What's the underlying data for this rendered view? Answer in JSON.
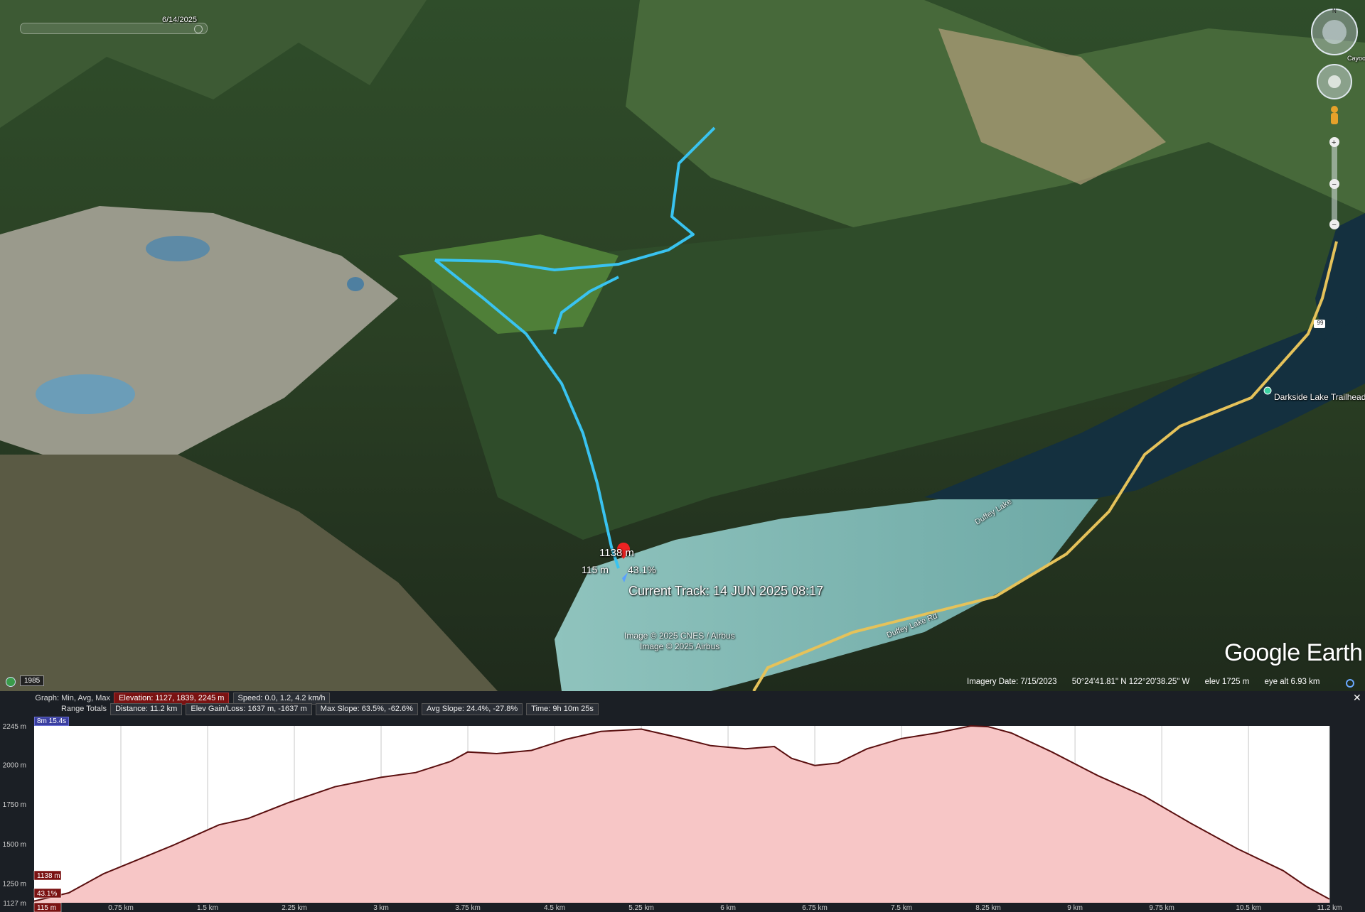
{
  "app": {
    "name": "Google Earth",
    "logo_text": "Google Earth"
  },
  "timeline": {
    "date": "6/14/2025",
    "year_badge": "1985"
  },
  "map": {
    "labels": {
      "elev_marker": "1138 m",
      "dist_marker": "115 m",
      "slope_marker": "43.1%",
      "current_track": "Current Track: 14 JUN 2025 08:17",
      "trailhead": "Darkside Lake Trailhead",
      "lake": "Duffey Lake",
      "road": "Duffey Lake Rd",
      "highway": "99",
      "cayoosh": "Cayoos",
      "credit1": "Image © 2025 CNES / Airbus",
      "credit2": "Image © 2025 Airbus"
    }
  },
  "status_bar": {
    "imagery_date": "Imagery Date: 7/15/2023",
    "coords": "50°24'41.81\" N  122°20'38.25\" W",
    "elev": "elev  1725 m",
    "eye_alt": "eye alt   6.93 km"
  },
  "profile": {
    "row1_label": "Graph: Min, Avg, Max",
    "elevation": "Elevation: 1127, 1839, 2245 m",
    "speed": "Speed: 0.0, 1.2, 4.2 km/h",
    "row2_label": "Range Totals",
    "distance": "Distance: 11.2 km",
    "elev_gain": "Elev Gain/Loss: 1637 m, -1637 m",
    "max_slope": "Max Slope: 63.5%, -62.6%",
    "avg_slope": "Avg Slope: 24.4%, -27.8%",
    "time": "Time: 9h 10m 25s",
    "time_badge": "8m 15.4s",
    "cursor_elev": "1138 m",
    "cursor_slope": "43.1%",
    "cursor_dist": "115 m"
  },
  "colors": {
    "fill": "#f7c6c6",
    "line": "#5a0f0f",
    "track": "#39c3f0"
  },
  "chart_data": {
    "type": "area",
    "xlabel": "",
    "ylabel": "",
    "x_unit": "km",
    "y_unit": "m",
    "xlim": [
      0,
      11.2
    ],
    "ylim": [
      1127,
      2245
    ],
    "x_ticks": [
      "0.75 km",
      "1.5 km",
      "2.25 km",
      "3 km",
      "3.75 km",
      "4.5 km",
      "5.25 km",
      "6 km",
      "6.75 km",
      "7.5 km",
      "8.25 km",
      "9 km",
      "9.75 km",
      "10.5 km",
      "11.2 km"
    ],
    "y_ticks": [
      "2245 m",
      "2000 m",
      "1750 m",
      "1500 m",
      "1250 m",
      "1127 m"
    ],
    "x": [
      0,
      0.3,
      0.6,
      0.9,
      1.2,
      1.6,
      1.85,
      2.2,
      2.6,
      3.0,
      3.3,
      3.6,
      3.75,
      4.0,
      4.3,
      4.6,
      4.9,
      5.25,
      5.55,
      5.85,
      6.15,
      6.4,
      6.55,
      6.75,
      6.95,
      7.2,
      7.5,
      7.8,
      8.1,
      8.25,
      8.45,
      8.8,
      9.2,
      9.6,
      10.0,
      10.4,
      10.8,
      11.0,
      11.2
    ],
    "y": [
      1138,
      1190,
      1310,
      1400,
      1490,
      1620,
      1660,
      1760,
      1860,
      1920,
      1950,
      2020,
      2080,
      2070,
      2090,
      2160,
      2210,
      2225,
      2175,
      2120,
      2100,
      2115,
      2040,
      1995,
      2010,
      2100,
      2165,
      2200,
      2245,
      2240,
      2200,
      2080,
      1930,
      1800,
      1630,
      1470,
      1330,
      1230,
      1150
    ]
  }
}
